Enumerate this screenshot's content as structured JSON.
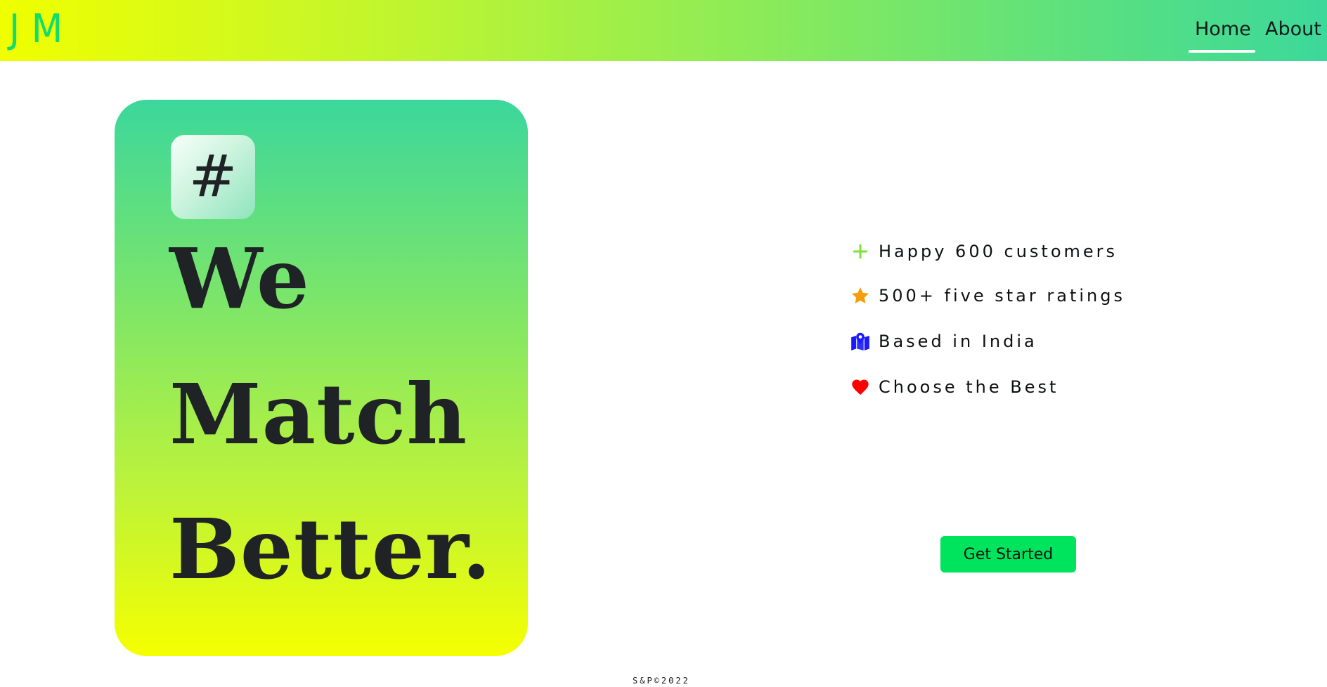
{
  "navbar": {
    "logo_text": "JM",
    "links": [
      {
        "label": "Home",
        "active": true
      },
      {
        "label": "About",
        "active": false
      }
    ],
    "gradient_start": "#f0ff00",
    "gradient_end": "#3cd89a",
    "logo_color": "#12dc6e"
  },
  "hero": {
    "badge_symbol": "#",
    "headline_lines": [
      "We",
      "Match",
      "Better."
    ],
    "card_gradient_top": "#3bd79c",
    "card_gradient_bottom": "#f5ff00"
  },
  "features": [
    {
      "icon": "plus-icon",
      "icon_color": "#7ee23a",
      "text": "Happy 600 customers"
    },
    {
      "icon": "star-icon",
      "icon_color": "#f59e0b",
      "text": "500+ five star ratings"
    },
    {
      "icon": "map-pin-icon",
      "icon_color": "#1a1aff",
      "text": "Based in India"
    },
    {
      "icon": "heart-icon",
      "icon_color": "#ff0000",
      "text": "Choose the Best"
    }
  ],
  "cta": {
    "label": "Get Started",
    "color": "#00e35c"
  },
  "footer": {
    "text": "S&P©2022"
  }
}
